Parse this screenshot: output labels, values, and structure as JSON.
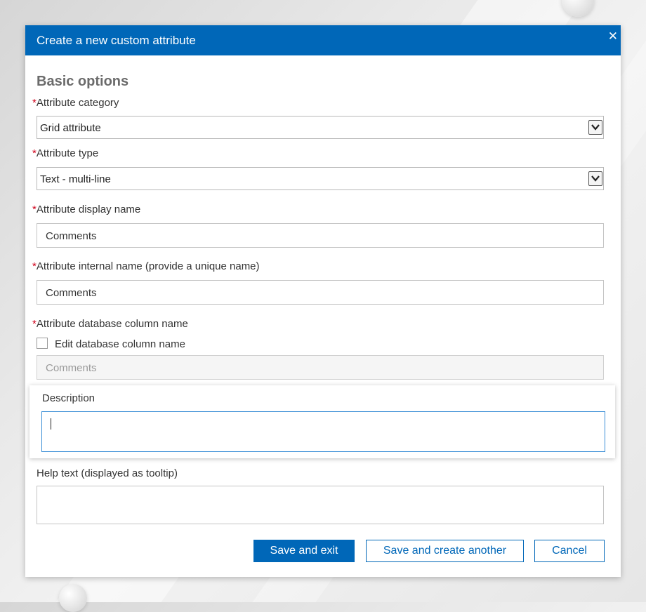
{
  "dialog": {
    "title": "Create a new custom attribute",
    "close_icon": "close-icon",
    "section_title": "Basic options",
    "required_marker": "*"
  },
  "fields": {
    "category": {
      "label": "Attribute category",
      "value": "Grid attribute"
    },
    "type": {
      "label": "Attribute type",
      "value": "Text - multi-line"
    },
    "display_name": {
      "label": "Attribute display name",
      "value": "Comments"
    },
    "internal_name": {
      "label": "Attribute internal name (provide a unique name)",
      "value": "Comments"
    },
    "db_column": {
      "label": "Attribute database column name",
      "checkbox_label": "Edit database column name",
      "checked": false,
      "value": "Comments"
    },
    "description": {
      "label": "Description",
      "value": ""
    },
    "help_text": {
      "label": "Help text (displayed as tooltip)",
      "value": ""
    }
  },
  "buttons": {
    "save_exit": "Save and exit",
    "save_another": "Save and create another",
    "cancel": "Cancel"
  },
  "colors": {
    "header": "#0067b8",
    "required": "#d0021b",
    "focus_border": "#3a8ed6"
  }
}
